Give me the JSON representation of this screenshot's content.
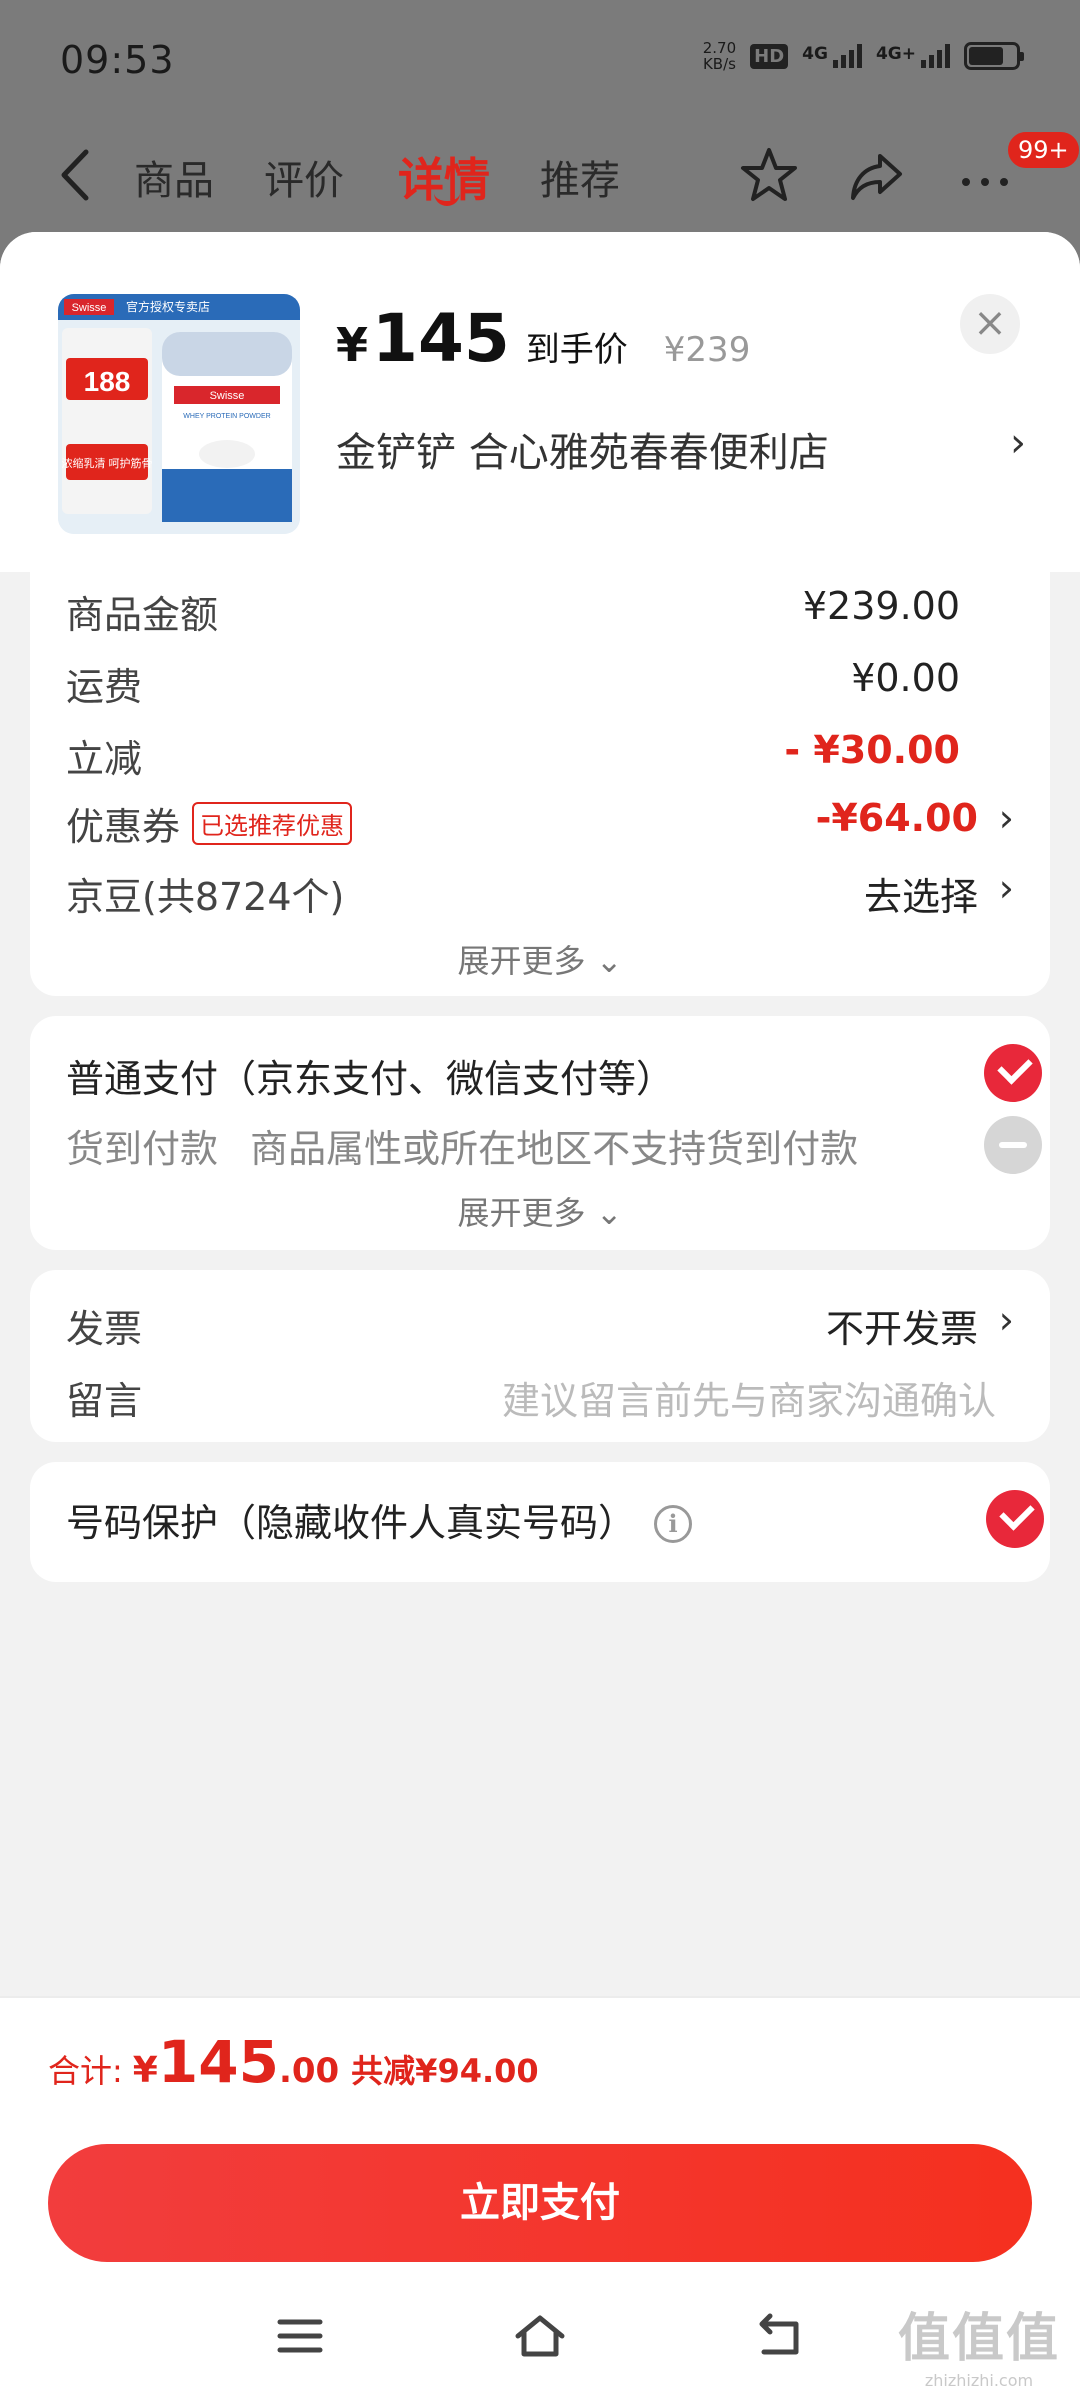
{
  "status_bar": {
    "time": "09:53",
    "net_speed_value": "2.70",
    "net_speed_unit": "KB/s",
    "hd_label": "HD",
    "sim1_label": "4G",
    "sim2_label": "4G+"
  },
  "nav": {
    "tabs": [
      "商品",
      "评价",
      "详情",
      "推荐"
    ],
    "active_tab": "详情",
    "badge": "99+"
  },
  "product": {
    "currency": "¥",
    "price": "145",
    "price_label": "到手价",
    "original_price": "¥239",
    "store": "金铲铲  合心雅苑春春便利店",
    "image_texts": {
      "brand": "Swisse",
      "store_badge": "官方授权专卖店",
      "promo_price": "188",
      "promo_line": "浓缩乳清 呵护筋骨",
      "can_title": "WHEY PROTEIN POWDER"
    }
  },
  "summary": {
    "cut_row_label": "商品金额",
    "cut_row_value": "¥239.00",
    "rows": [
      {
        "label": "运费",
        "value": "¥0.00"
      },
      {
        "label": "立减",
        "value": "- ¥30.00"
      },
      {
        "label": "优惠券",
        "tag": "已选推荐优惠",
        "value": "-¥64.00"
      },
      {
        "label": "京豆(共8724个)",
        "value": "去选择"
      }
    ],
    "expand_more": "展开更多"
  },
  "payment": {
    "options": [
      {
        "label": "普通支付（京东支付、微信支付等）",
        "selected": true
      },
      {
        "label": "货到付款",
        "note": "商品属性或所在地区不支持货到付款",
        "selected": false
      }
    ],
    "expand_more": "展开更多"
  },
  "invoice": {
    "label": "发票",
    "value": "不开发票",
    "message_label": "留言",
    "message_placeholder": "建议留言前先与商家沟通确认"
  },
  "privacy": {
    "label": "号码保护（隐藏收件人真实号码）",
    "enabled": true
  },
  "footer": {
    "total_label": "合计:",
    "total_currency": "¥",
    "total_int": "145",
    "total_dec": ".00",
    "saved_text": "共减¥94.00",
    "pay_button": "立即支付"
  },
  "watermark": {
    "line1": "值值值",
    "line2": "zhizhizhi.com"
  },
  "colors": {
    "accent": "#e0251c",
    "check": "#e8283a"
  }
}
